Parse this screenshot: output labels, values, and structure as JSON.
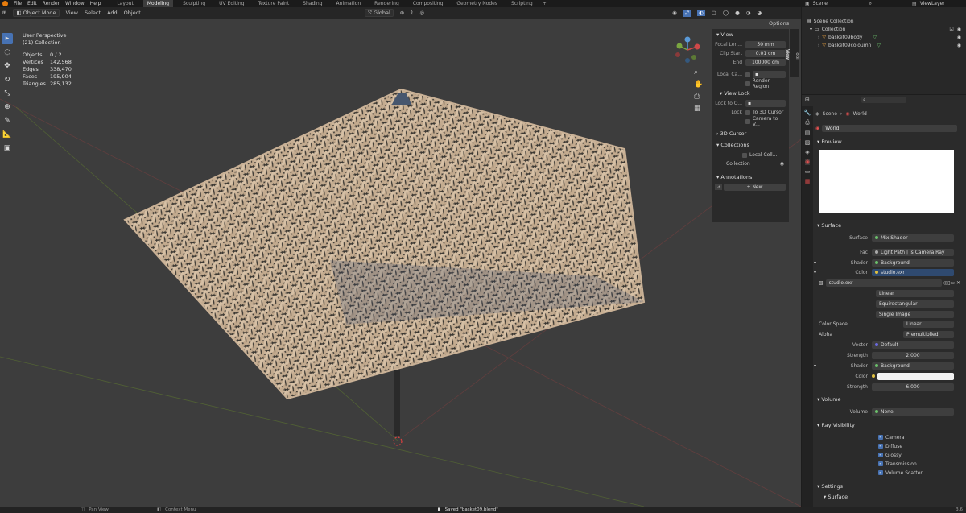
{
  "topbar": {
    "menus": [
      "File",
      "Edit",
      "Render",
      "Window",
      "Help"
    ],
    "workspaces": [
      "Layout",
      "Modeling",
      "Sculpting",
      "UV Editing",
      "Texture Paint",
      "Shading",
      "Animation",
      "Rendering",
      "Compositing",
      "Geometry Nodes",
      "Scripting"
    ],
    "active_workspace": "Modeling",
    "add": "+",
    "scene": "Scene",
    "viewlayer": "ViewLayer"
  },
  "viewport_header": {
    "mode": "Object Mode",
    "menus": [
      "View",
      "Select",
      "Add",
      "Object"
    ],
    "orientation": "Global",
    "options": "Options"
  },
  "overlay": {
    "perspective": "User Perspective",
    "collection": "(21) Collection",
    "stats": [
      {
        "k": "Objects",
        "v": "0 / 2"
      },
      {
        "k": "Vertices",
        "v": "142,568"
      },
      {
        "k": "Edges",
        "v": "338,470"
      },
      {
        "k": "Faces",
        "v": "195,904"
      },
      {
        "k": "Triangles",
        "v": "285,132"
      }
    ]
  },
  "npanel": {
    "view": "View",
    "focal_label": "Focal Len...",
    "focal_value": "50 mm",
    "clip_start_label": "Clip Start",
    "clip_start_value": "0.01 cm",
    "end_label": "End",
    "end_value": "100000 cm",
    "local_camera": "Local Ca...",
    "render_region": "Render Region",
    "view_lock": "View Lock",
    "lock_to": "Lock to O...",
    "lock": "Lock",
    "to_3d_cursor": "To 3D Cursor",
    "camera_to_view": "Camera to V...",
    "cursor_3d": "3D Cursor",
    "collections": "Collections",
    "local_coll": "Local Coll...",
    "collection": "Collection",
    "annotations": "Annotations",
    "new": "New",
    "tabs": [
      "Tool",
      "View"
    ]
  },
  "outliner": {
    "scene_collection": "Scene Collection",
    "collection": "Collection",
    "items": [
      "basket09body",
      "basket09coloumn"
    ]
  },
  "properties": {
    "breadcrumb_scene": "Scene",
    "breadcrumb_world": "World",
    "world_name": "World",
    "preview": "Preview",
    "surface": "Surface",
    "surface_label": "Surface",
    "surface_value": "Mix Shader",
    "fac_label": "Fac",
    "fac_value": "Light Path | Is Camera Ray",
    "shader1_label": "Shader",
    "shader1_value": "Background",
    "color_label": "Color",
    "color_value": "studio.exr",
    "image_name": "studio.exr",
    "interp": "Linear",
    "projection": "Equirectangular",
    "source": "Single Image",
    "colorspace_label": "Color Space",
    "colorspace_value": "Linear",
    "alpha_label": "Alpha",
    "alpha_value": "Premultiplied",
    "vector_label": "Vector",
    "vector_value": "Default",
    "strength1_label": "Strength",
    "strength1_value": "2.000",
    "shader2_label": "Shader",
    "shader2_value": "Background",
    "color2_label": "Color",
    "strength2_label": "Strength",
    "strength2_value": "6.000",
    "volume": "Volume",
    "volume_label": "Volume",
    "volume_value": "None",
    "ray_visibility": "Ray Visibility",
    "rays": [
      "Camera",
      "Diffuse",
      "Glossy",
      "Transmission",
      "Volume Scatter"
    ],
    "settings": "Settings",
    "settings_surface": "Surface"
  },
  "statusbar": {
    "pan": "Pan View",
    "context": "Context Menu",
    "saved": "Saved \"basket09.blend\"",
    "version": "3.6"
  },
  "colors": {
    "basket": "#cdb59a",
    "viewport": "#3d3d3d",
    "accent": "#4772b3"
  }
}
